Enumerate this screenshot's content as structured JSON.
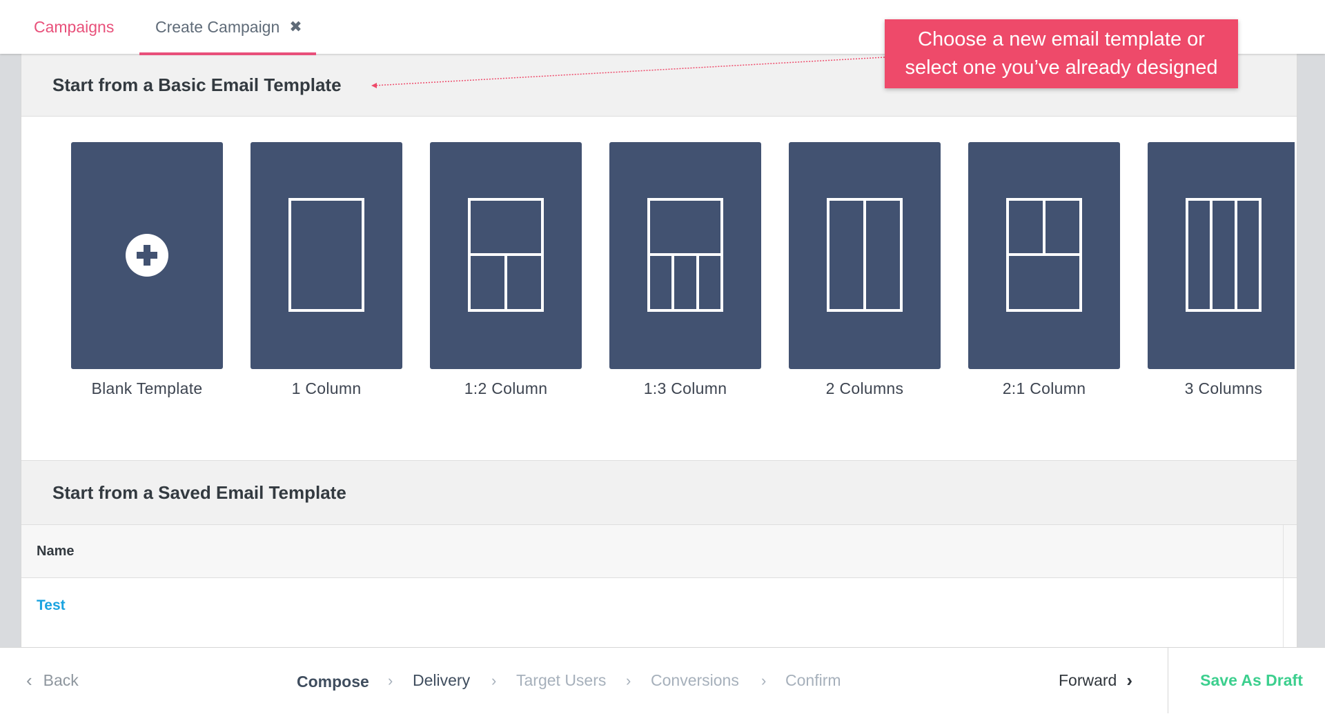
{
  "tabs": {
    "campaigns": "Campaigns",
    "create_campaign": "Create Campaign",
    "close_glyph": "✖"
  },
  "callout": {
    "line1": "Choose a new email template or",
    "line2": "select one you’ve already designed"
  },
  "basic_section": {
    "title": "Start from a Basic Email Template",
    "templates": [
      {
        "label": "Blank Template",
        "icon": "plus-circle-icon"
      },
      {
        "label": "1 Column",
        "icon": "layout-1-column-icon"
      },
      {
        "label": "1:2 Column",
        "icon": "layout-1-2-column-icon"
      },
      {
        "label": "1:3 Column",
        "icon": "layout-1-3-column-icon"
      },
      {
        "label": "2 Columns",
        "icon": "layout-2-columns-icon"
      },
      {
        "label": "2:1 Column",
        "icon": "layout-2-1-column-icon"
      },
      {
        "label": "3 Columns",
        "icon": "layout-3-columns-icon"
      }
    ]
  },
  "saved_section": {
    "title": "Start from a Saved Email Template",
    "table": {
      "columns": [
        "Name"
      ],
      "rows": [
        [
          "Test"
        ]
      ]
    }
  },
  "footer": {
    "back": "Back",
    "steps": [
      "Compose",
      "Delivery",
      "Target Users",
      "Conversions",
      "Confirm"
    ],
    "active_step": "Compose",
    "forward": "Forward",
    "save_draft": "Save As Draft"
  },
  "colors": {
    "accent_pink": "#e8507a",
    "callout": "#ee4a6a",
    "card": "#425271",
    "link_blue": "#1aa3e0",
    "save_green": "#3ccf8e"
  }
}
